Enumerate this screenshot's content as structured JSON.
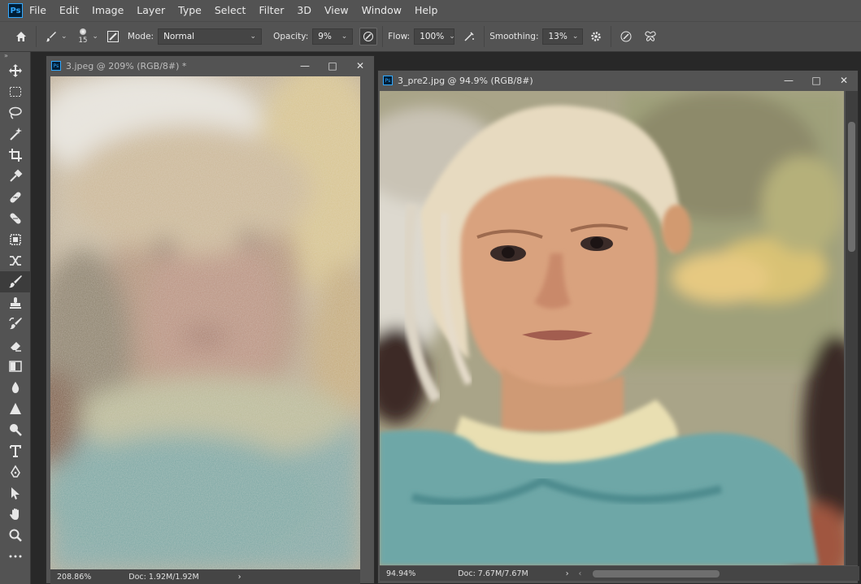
{
  "app": {
    "logo_text": "Ps"
  },
  "menu": [
    "File",
    "Edit",
    "Image",
    "Layer",
    "Type",
    "Select",
    "Filter",
    "3D",
    "View",
    "Window",
    "Help"
  ],
  "options": {
    "brush_size": "15",
    "mode_label": "Mode:",
    "mode_value": "Normal",
    "opacity_label": "Opacity:",
    "opacity_value": "9%",
    "flow_label": "Flow:",
    "flow_value": "100%",
    "smoothing_label": "Smoothing:",
    "smoothing_value": "13%"
  },
  "tools": [
    {
      "name": "move-tool",
      "icon": "move-icon"
    },
    {
      "name": "marquee-tool",
      "icon": "marquee-icon"
    },
    {
      "name": "lasso-tool",
      "icon": "lasso-icon"
    },
    {
      "name": "magic-wand-tool",
      "icon": "magic-wand-icon"
    },
    {
      "name": "crop-tool",
      "icon": "crop-icon"
    },
    {
      "name": "eyedropper-tool",
      "icon": "eyedropper-icon"
    },
    {
      "name": "spot-healing-tool",
      "icon": "bandage-icon"
    },
    {
      "name": "patch-tool",
      "icon": "patch-icon"
    },
    {
      "name": "frame-tool",
      "icon": "frame-icon"
    },
    {
      "name": "content-aware-move-tool",
      "icon": "cross-arrows-icon"
    },
    {
      "name": "brush-tool",
      "icon": "brush-icon",
      "active": true
    },
    {
      "name": "clone-stamp-tool",
      "icon": "stamp-icon"
    },
    {
      "name": "history-brush-tool",
      "icon": "history-brush-icon"
    },
    {
      "name": "eraser-tool",
      "icon": "eraser-icon"
    },
    {
      "name": "gradient-tool",
      "icon": "gradient-icon"
    },
    {
      "name": "blur-tool",
      "icon": "drop-icon"
    },
    {
      "name": "sharpen-tool",
      "icon": "triangle-icon"
    },
    {
      "name": "dodge-tool",
      "icon": "dodge-icon"
    },
    {
      "name": "type-tool",
      "icon": "type-icon"
    },
    {
      "name": "pen-tool",
      "icon": "pen-icon"
    },
    {
      "name": "path-selection-tool",
      "icon": "arrow-icon"
    },
    {
      "name": "hand-tool",
      "icon": "hand-icon"
    },
    {
      "name": "zoom-tool",
      "icon": "zoom-icon"
    },
    {
      "name": "more-tools",
      "icon": "ellipsis-icon"
    }
  ],
  "docs": [
    {
      "title": "3.jpeg @ 209% (RGB/8#) *",
      "zoom": "208.86%",
      "doc_info": "Doc: 1.92M/1.92M"
    },
    {
      "title": "3_pre2.jpg @ 94.9% (RGB/8#)",
      "zoom": "94.94%",
      "doc_info": "Doc: 7.67M/7.67M"
    }
  ],
  "window_controls": {
    "minimize": "—",
    "restore": "□",
    "close": "✕"
  },
  "colors": {
    "ui_bg": "#535353",
    "workspace": "#282828",
    "ps_blue": "#31a8ff"
  }
}
